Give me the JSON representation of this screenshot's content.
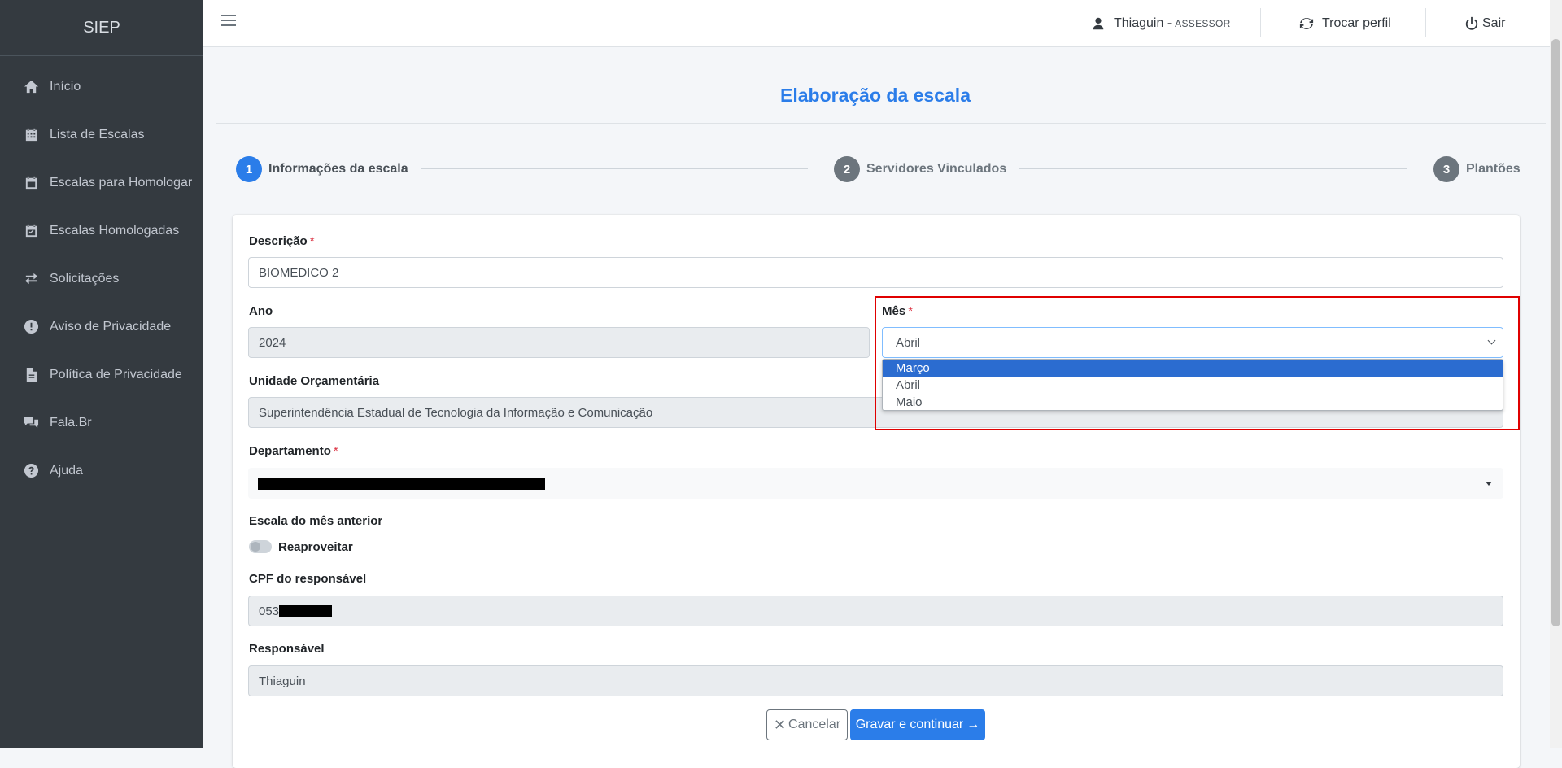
{
  "app": {
    "brand": "SIEP"
  },
  "sidebar": {
    "items": [
      {
        "label": "Início",
        "icon": "home-icon"
      },
      {
        "label": "Lista de Escalas",
        "icon": "calendar-grid-icon"
      },
      {
        "label": "Escalas para Homologar",
        "icon": "calendar-icon"
      },
      {
        "label": "Escalas Homologadas",
        "icon": "calendar-check-icon"
      },
      {
        "label": "Solicitações",
        "icon": "exchange-icon"
      },
      {
        "label": "Aviso de Privacidade",
        "icon": "exclamation-circle-icon"
      },
      {
        "label": "Política de Privacidade",
        "icon": "file-icon"
      },
      {
        "label": "Fala.Br",
        "icon": "comments-icon"
      },
      {
        "label": "Ajuda",
        "icon": "question-circle-icon"
      }
    ]
  },
  "topbar": {
    "user_name": "Thiaguin -",
    "user_role": "ASSESSOR",
    "switch_profile": "Trocar perfil",
    "logout": "Sair"
  },
  "page": {
    "title": "Elaboração da escala"
  },
  "stepper": {
    "steps": [
      {
        "number": "1",
        "label": "Informações da escala"
      },
      {
        "number": "2",
        "label": "Servidores Vinculados"
      },
      {
        "number": "3",
        "label": "Plantões"
      }
    ]
  },
  "form": {
    "descricao": {
      "label": "Descrição",
      "required": "*",
      "value": "BIOMEDICO 2"
    },
    "ano": {
      "label": "Ano",
      "value": "2024"
    },
    "mes": {
      "label": "Mês",
      "required": "*",
      "value": "Abril",
      "options": [
        "Março",
        "Abril",
        "Maio"
      ]
    },
    "unidade": {
      "label": "Unidade Orçamentária",
      "value": "Superintendência Estadual de Tecnologia da Informação e Comunicação"
    },
    "departamento": {
      "label": "Departamento",
      "required": "*"
    },
    "escala_anterior": {
      "label": "Escala do mês anterior",
      "toggle_label": "Reaproveitar"
    },
    "cpf": {
      "label": "CPF do responsável",
      "value": "053"
    },
    "responsavel": {
      "label": "Responsável",
      "value": "Thiaguin"
    }
  },
  "actions": {
    "cancel": "Cancelar",
    "save": "Gravar e continuar"
  },
  "colors": {
    "primary": "#2b7de9",
    "sidebar": "#343a40",
    "highlight": "#e00000"
  }
}
